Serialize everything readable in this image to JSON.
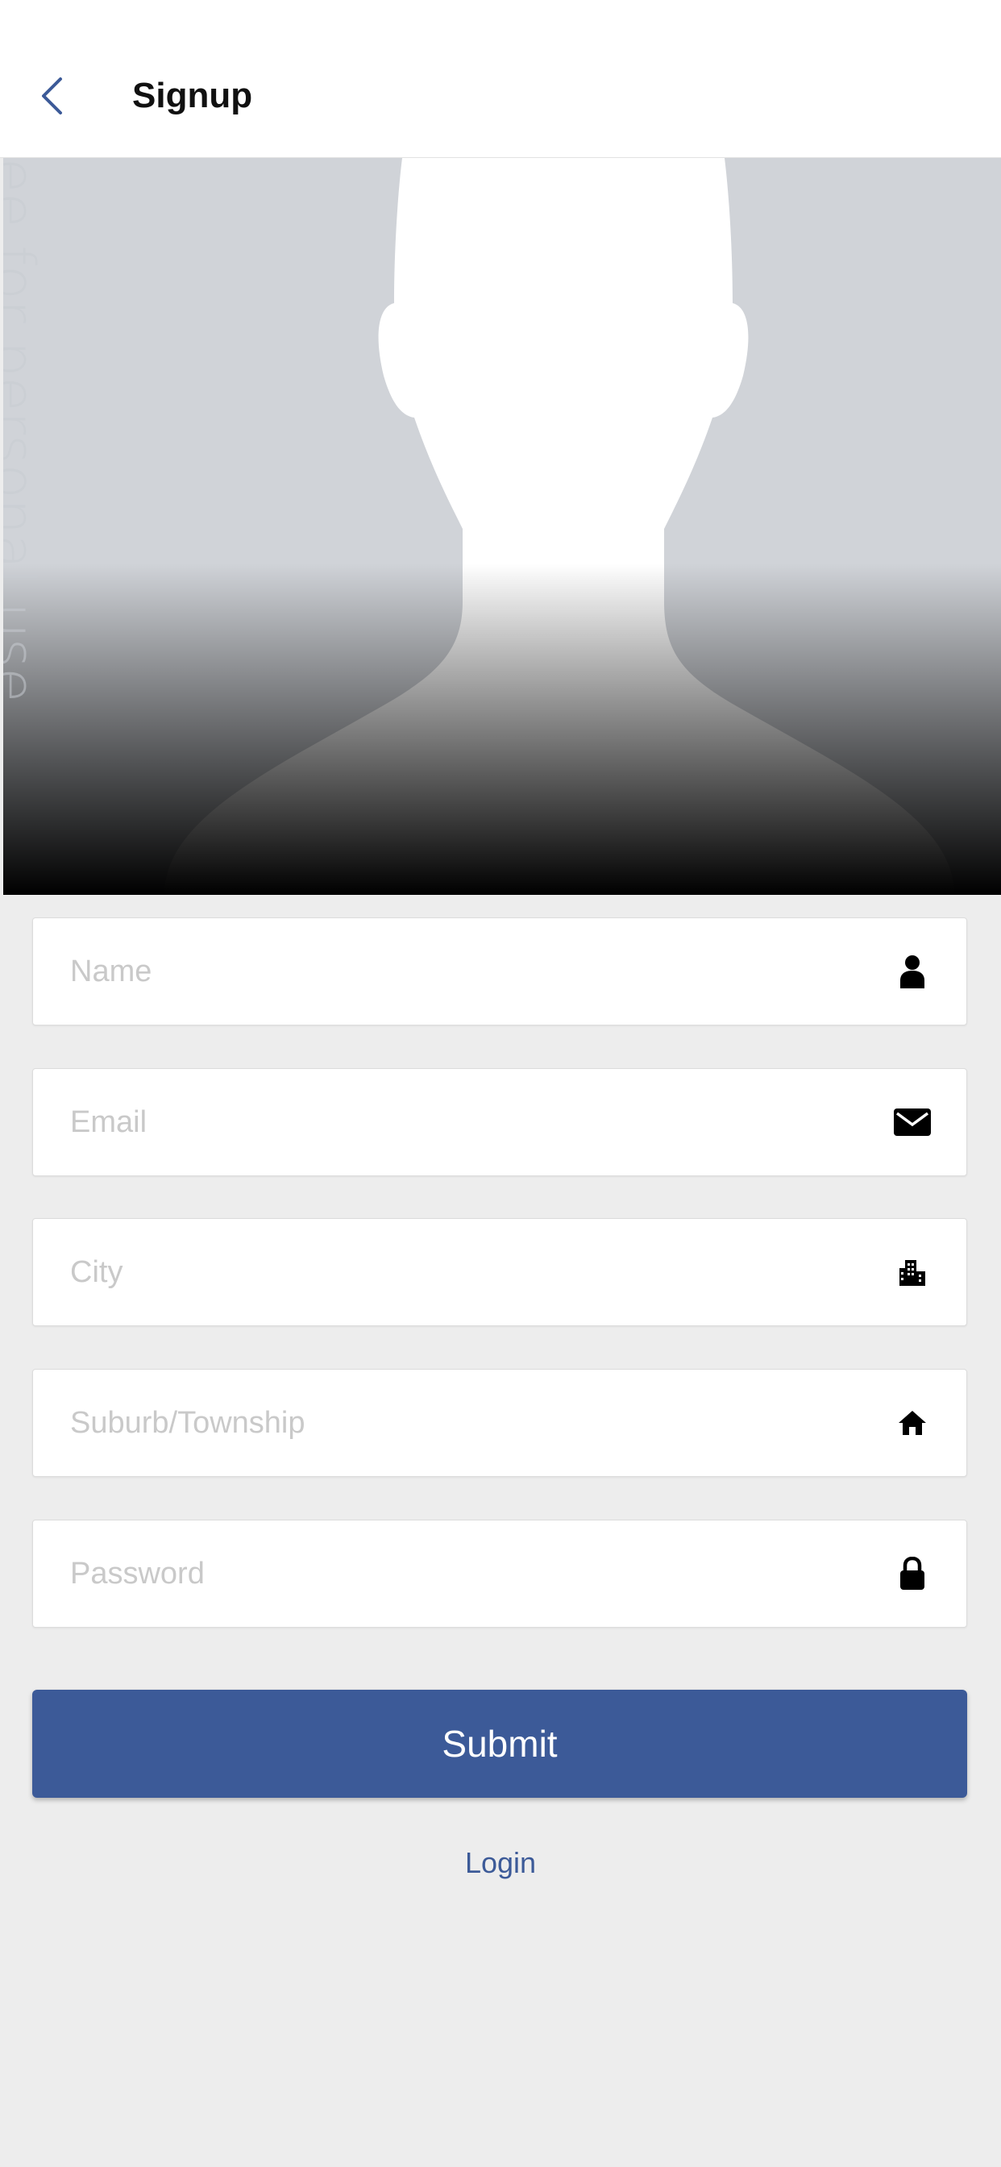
{
  "header": {
    "title": "Signup",
    "back_icon": "chevron-left-icon"
  },
  "watermark": "ee for personal use",
  "form": {
    "fields": [
      {
        "placeholder": "Name",
        "value": "",
        "icon": "user-icon"
      },
      {
        "placeholder": "Email",
        "value": "",
        "icon": "envelope-icon"
      },
      {
        "placeholder": "City",
        "value": "",
        "icon": "city-icon"
      },
      {
        "placeholder": "Suburb/Township",
        "value": "",
        "icon": "home-icon"
      },
      {
        "placeholder": "Password",
        "value": "",
        "icon": "lock-icon"
      }
    ],
    "submit_label": "Submit",
    "login_label": "Login"
  },
  "colors": {
    "accent": "#3c5a98",
    "background": "#ededed",
    "hero_bg": "#d0d3d8"
  }
}
